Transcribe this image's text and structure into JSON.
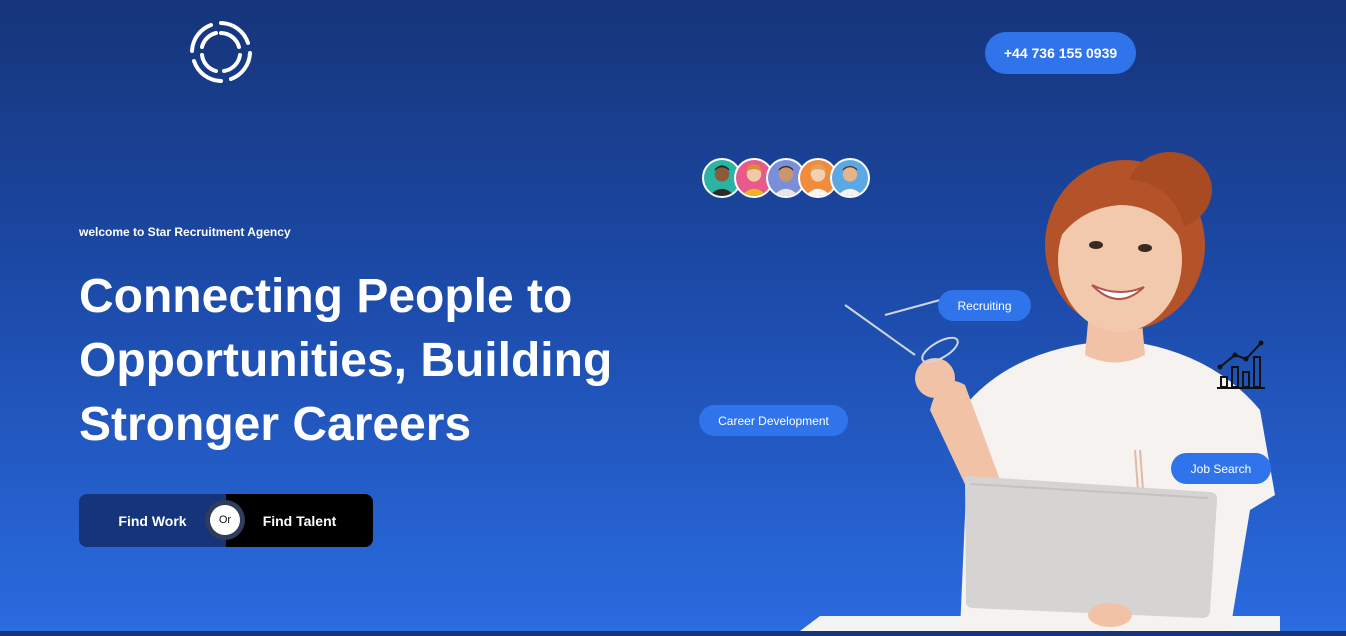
{
  "header": {
    "logo": "swirl-logo-icon",
    "phone_label": "+44 736 155 0939"
  },
  "hero": {
    "welcome_text": "welcome to Star Recruitment Agency",
    "headline_line1": "Connecting People to",
    "headline_line2": "Opportunities, Building",
    "headline_line3": "Stronger Careers",
    "find_work_label": "Find Work",
    "or_label": "Or",
    "find_talent_label": "Find Talent"
  },
  "tags": {
    "recruiting": "Recruiting",
    "career_development": "Career Development",
    "job_search": "Job Search"
  },
  "avatars": [
    "avatar-1",
    "avatar-2",
    "avatar-3",
    "avatar-4",
    "avatar-5"
  ],
  "colors": {
    "bg_top": "#16357a",
    "bg_bottom": "#2a6be0",
    "accent": "#2f74ea",
    "dark_button": "#15347a"
  }
}
